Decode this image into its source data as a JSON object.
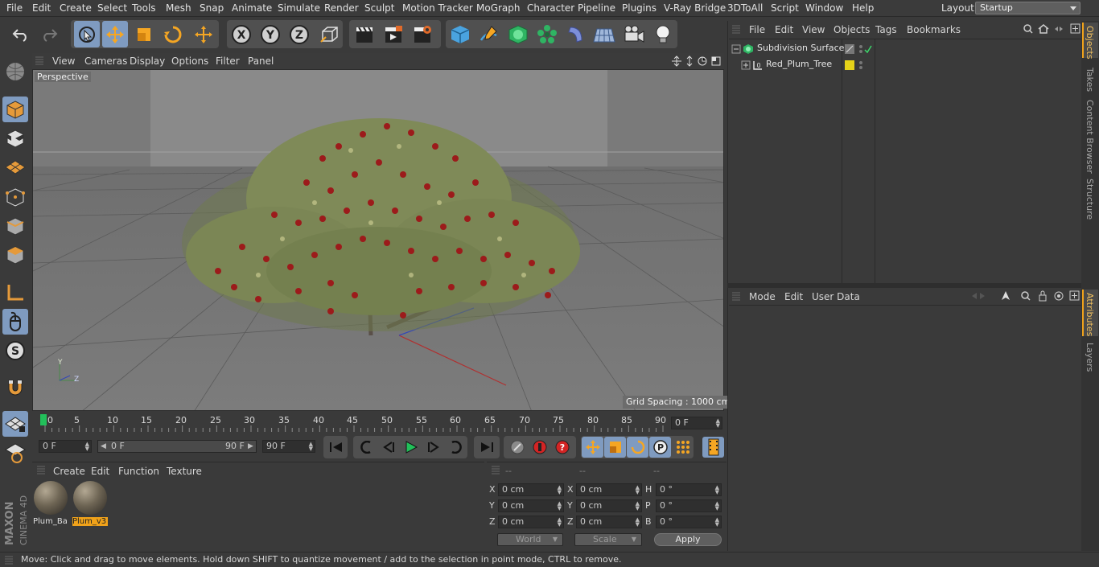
{
  "menu": [
    "File",
    "Edit",
    "Create",
    "Select",
    "Tools",
    "Mesh",
    "Snap",
    "Animate",
    "Simulate",
    "Render",
    "Sculpt",
    "Motion Tracker",
    "MoGraph",
    "Character",
    "Pipeline",
    "Plugins",
    "V-Ray Bridge",
    "3DToAll",
    "Script",
    "Window",
    "Help"
  ],
  "layout": {
    "label": "Layout:",
    "value": "Startup"
  },
  "viewport": {
    "menu": [
      "View",
      "Cameras",
      "Display",
      "Options",
      "Filter",
      "Panel"
    ],
    "camera": "Perspective",
    "grid_spacing": "Grid Spacing : 1000 cm",
    "axis_y": "Y",
    "axis_z": "Z"
  },
  "timeline": {
    "ticks": [
      "0",
      "5",
      "10",
      "15",
      "20",
      "25",
      "30",
      "35",
      "40",
      "45",
      "50",
      "55",
      "60",
      "65",
      "70",
      "75",
      "80",
      "85",
      "90"
    ],
    "current_frame": "0 F",
    "start": "0 F",
    "range_start": "0 F",
    "range_end": "90 F",
    "end": "90 F"
  },
  "materials": {
    "menu": [
      "Create",
      "Edit",
      "Function",
      "Texture"
    ],
    "items": [
      {
        "name": "Plum_Ba"
      },
      {
        "name": "Plum_v3"
      }
    ]
  },
  "coords": {
    "headers": [
      "--",
      "--",
      "--"
    ],
    "rows": [
      [
        "X",
        "0 cm",
        "X",
        "0 cm",
        "H",
        "0 °"
      ],
      [
        "Y",
        "0 cm",
        "Y",
        "0 cm",
        "P",
        "0 °"
      ],
      [
        "Z",
        "0 cm",
        "Z",
        "0 cm",
        "B",
        "0 °"
      ]
    ],
    "world": "World",
    "scale": "Scale",
    "apply": "Apply"
  },
  "objects": {
    "menu": [
      "File",
      "Edit",
      "View",
      "Objects",
      "Tags",
      "Bookmarks"
    ],
    "items": [
      {
        "name": "Subdivision Surface"
      },
      {
        "name": "Red_Plum_Tree"
      }
    ]
  },
  "attributes": {
    "menu": [
      "Mode",
      "Edit",
      "User Data"
    ]
  },
  "sidetabs": [
    "Objects",
    "Takes",
    "Content Browser",
    "Structure"
  ],
  "sidetabs2": [
    "Attributes",
    "Layers"
  ],
  "brand": {
    "maxon": "MAXON",
    "product": "CINEMA 4D"
  },
  "status": "Move: Click and drag to move elements. Hold down SHIFT to quantize movement / add to the selection in point mode, CTRL to remove."
}
